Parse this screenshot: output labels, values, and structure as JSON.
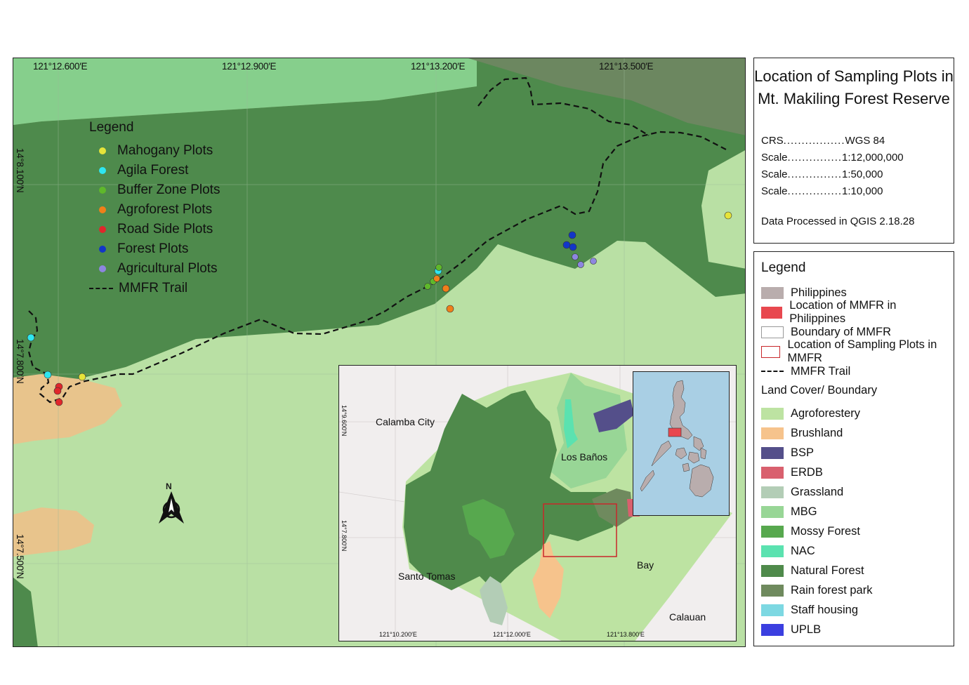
{
  "main_map": {
    "top_coords": [
      "121°12.600′E",
      "121°12.900′E",
      "121°13.200′E",
      "121°13.500′E"
    ],
    "left_coords": [
      "14°8.100′N",
      "14°7.800′N",
      "14°7.500′N"
    ],
    "legend": {
      "title": "Legend",
      "items": [
        {
          "label": "Mahogany Plots",
          "color": "#e6e43a"
        },
        {
          "label": "Agila Forest",
          "color": "#2ee6f0"
        },
        {
          "label": "Buffer Zone Plots",
          "color": "#5fb82b"
        },
        {
          "label": "Agroforest Plots",
          "color": "#f07f1a"
        },
        {
          "label": "Road Side Plots",
          "color": "#e0272b"
        },
        {
          "label": "Forest Plots",
          "color": "#1236c8"
        },
        {
          "label": "Agricultural Plots",
          "color": "#8d86e0"
        }
      ],
      "trail_label": "MMFR Trail"
    },
    "north_label": "N"
  },
  "inset": {
    "places": [
      "Calamba City",
      "Los Baños",
      "Santo Tomas",
      "Bay",
      "Calauan"
    ],
    "bottom_coords": [
      "121°10.200′E",
      "121°12.000′E",
      "121°13.800′E"
    ],
    "left_coords": [
      "14°9.600′N",
      "14°7.800′N"
    ]
  },
  "title_box": {
    "title_line1": "Location of Sampling Plots in",
    "title_line2": "Mt. Makiling Forest Reserve",
    "crs_key": "CRS",
    "crs_value": "WGS 84",
    "scale_key": "Scale",
    "scales": [
      "1:12,000,000",
      "1:50,000",
      "1:10,000"
    ],
    "processed": "Data Processed in QGIS 2.18.28"
  },
  "legend_box": {
    "title": "Legend",
    "items": [
      {
        "label": "Philippines",
        "color": "#b9adad",
        "style": "fill"
      },
      {
        "label": "Location of MMFR in Philippines",
        "color": "#e8484f",
        "style": "fill"
      },
      {
        "label": "Boundary of MMFR",
        "color": "#ffffff",
        "style": "outline-gray"
      },
      {
        "label": "Location of Sampling Plots in MMFR",
        "color": "#c8272b",
        "style": "outline-red"
      },
      {
        "label": "MMFR Trail",
        "color": "#111111",
        "style": "dash"
      }
    ],
    "land_cover_title": "Land Cover/ Boundary",
    "land_cover": [
      {
        "label": "Agroforestery",
        "color": "#bde3a2"
      },
      {
        "label": "Brushland",
        "color": "#f6c38c"
      },
      {
        "label": "BSP",
        "color": "#544f8a"
      },
      {
        "label": "ERDB",
        "color": "#d9606e"
      },
      {
        "label": "Grassland",
        "color": "#b3cdb6"
      },
      {
        "label": "MBG",
        "color": "#98d696"
      },
      {
        "label": "Mossy Forest",
        "color": "#57a84e"
      },
      {
        "label": "NAC",
        "color": "#5be2b0"
      },
      {
        "label": "Natural Forest",
        "color": "#4f8a4b"
      },
      {
        "label": "Rain forest park",
        "color": "#6f8a5e"
      },
      {
        "label": "Staff housing",
        "color": "#7dd8e2"
      },
      {
        "label": "UPLB",
        "color": "#3b3fe0"
      }
    ]
  }
}
